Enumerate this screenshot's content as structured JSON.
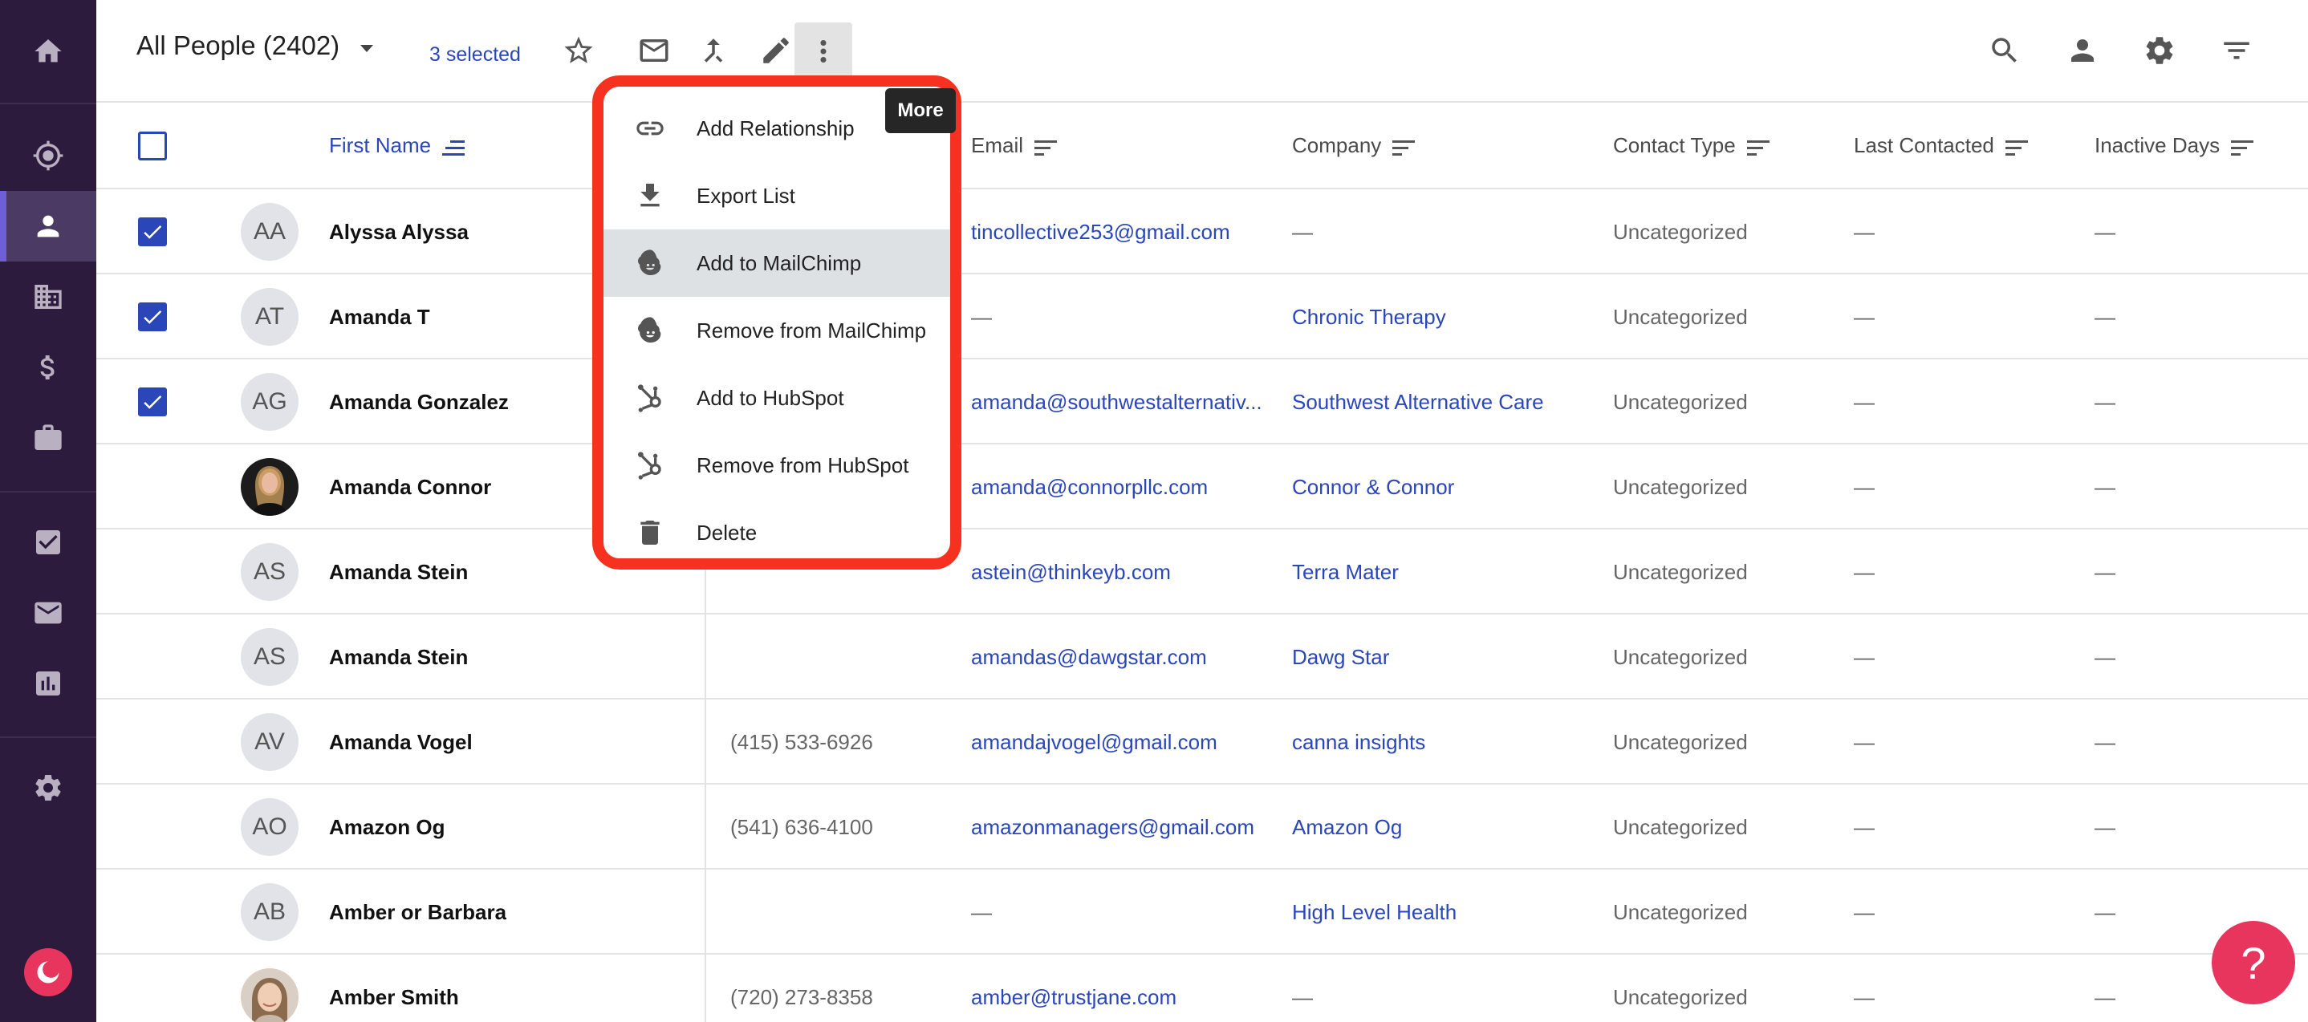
{
  "header": {
    "view_title": "All People (2402)",
    "selected_text": "3 selected",
    "tooltip": "More"
  },
  "columns": {
    "first_name": "First Name",
    "email": "Email",
    "company": "Company",
    "contact_type": "Contact Type",
    "last_contacted": "Last Contacted",
    "inactive_days": "Inactive Days"
  },
  "menu": {
    "items": [
      {
        "label": "Add Relationship",
        "icon": "link-icon"
      },
      {
        "label": "Export List",
        "icon": "download-icon"
      },
      {
        "label": "Add to MailChimp",
        "icon": "mailchimp-icon"
      },
      {
        "label": "Remove from MailChimp",
        "icon": "mailchimp-icon"
      },
      {
        "label": "Add to HubSpot",
        "icon": "hubspot-icon"
      },
      {
        "label": "Remove from HubSpot",
        "icon": "hubspot-icon"
      },
      {
        "label": "Delete",
        "icon": "trash-icon"
      }
    ]
  },
  "rows": [
    {
      "checked": true,
      "initials": "AA",
      "name": "Alyssa Alyssa",
      "phone": "",
      "email": "tincollective253@gmail.com",
      "company": "—",
      "type": "Uncategorized",
      "last": "—",
      "inactive": "—"
    },
    {
      "checked": true,
      "initials": "AT",
      "name": "Amanda T",
      "phone": "",
      "email": "—",
      "company": "Chronic Therapy",
      "type": "Uncategorized",
      "last": "—",
      "inactive": "—"
    },
    {
      "checked": true,
      "initials": "AG",
      "name": "Amanda Gonzalez",
      "phone": "",
      "email": "amanda@southwestalternativ...",
      "company": "Southwest Alternative Care",
      "type": "Uncategorized",
      "last": "—",
      "inactive": "—"
    },
    {
      "checked": false,
      "initials": "",
      "name": "Amanda Connor",
      "phone": "",
      "email": "amanda@connorpllc.com",
      "company": "Connor & Connor",
      "type": "Uncategorized",
      "last": "—",
      "inactive": "—"
    },
    {
      "checked": false,
      "initials": "AS",
      "name": "Amanda Stein",
      "phone": "",
      "email": "astein@thinkeyb.com",
      "company": "Terra Mater",
      "type": "Uncategorized",
      "last": "—",
      "inactive": "—"
    },
    {
      "checked": false,
      "initials": "AS",
      "name": "Amanda Stein",
      "phone": "",
      "email": "amandas@dawgstar.com",
      "company": "Dawg Star",
      "type": "Uncategorized",
      "last": "—",
      "inactive": "—"
    },
    {
      "checked": false,
      "initials": "AV",
      "name": "Amanda Vogel",
      "phone": "(415) 533-6926",
      "email": "amandajvogel@gmail.com",
      "company": "canna insights",
      "type": "Uncategorized",
      "last": "—",
      "inactive": "—"
    },
    {
      "checked": false,
      "initials": "AO",
      "name": "Amazon Og",
      "phone": "(541) 636-4100",
      "email": "amazonmanagers@gmail.com",
      "company": "Amazon Og",
      "type": "Uncategorized",
      "last": "—",
      "inactive": "—"
    },
    {
      "checked": false,
      "initials": "AB",
      "name": "Amber or Barbara",
      "phone": "",
      "email": "—",
      "company": "High Level Health",
      "type": "Uncategorized",
      "last": "—",
      "inactive": "—"
    },
    {
      "checked": false,
      "initials": "",
      "name": "Amber Smith",
      "phone": "(720) 273-8358",
      "email": "amber@trustjane.com",
      "company": "—",
      "type": "Uncategorized",
      "last": "—",
      "inactive": "—"
    }
  ],
  "help": {
    "label": "?"
  },
  "colors": {
    "sidebar": "#2d1b3d",
    "accent": "#2a46b8",
    "highlight_border": "#f7311f",
    "help": "#e8355e"
  }
}
